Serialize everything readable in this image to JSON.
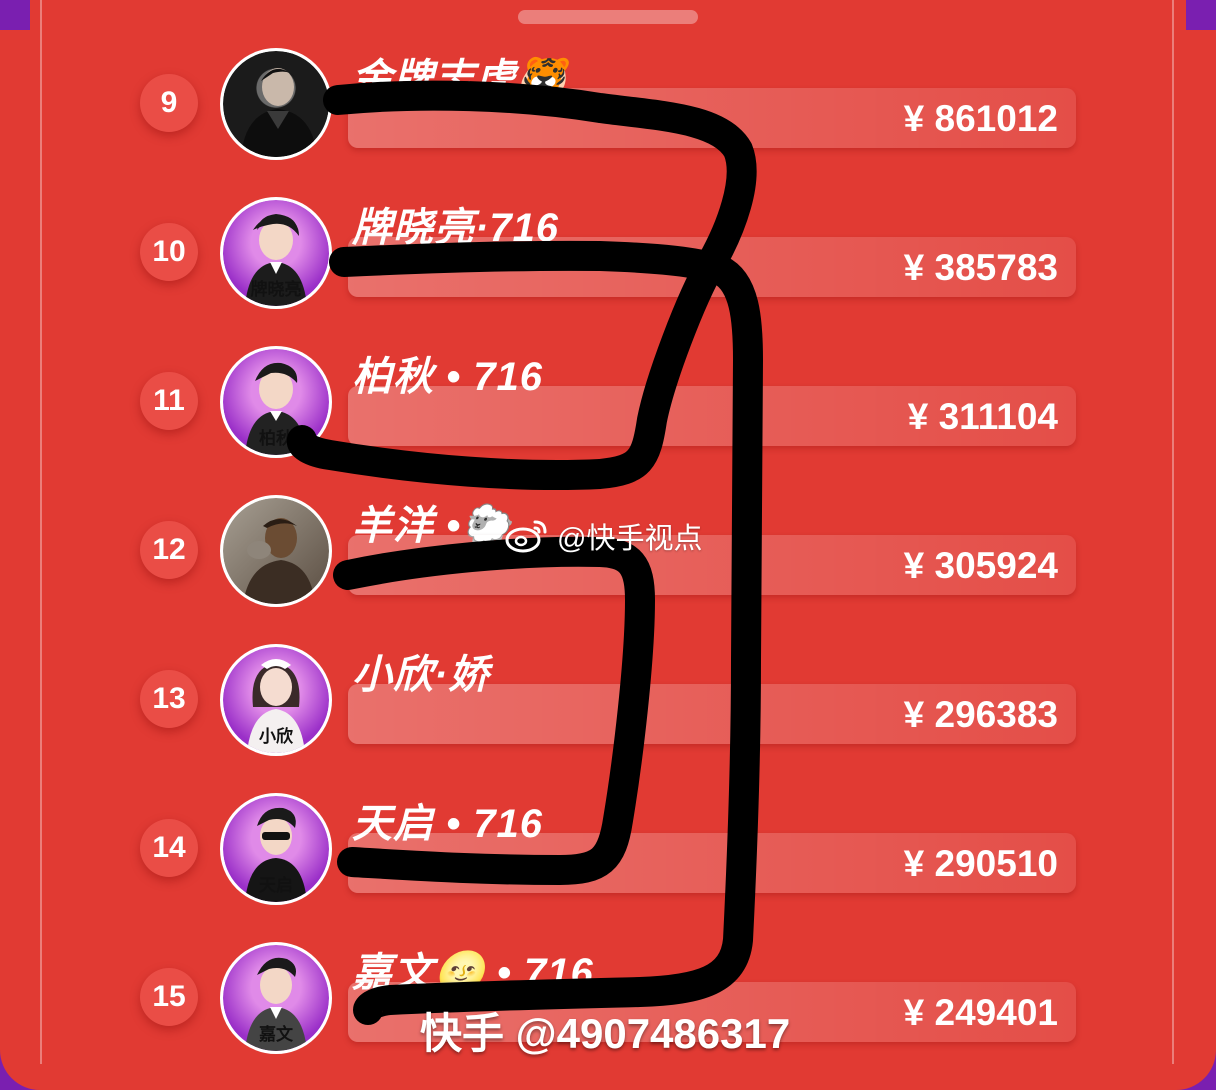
{
  "leaderboard": {
    "rows": [
      {
        "rank": "9",
        "name": "金牌志虎",
        "name_emoji": "🐯",
        "avatar_caption": "",
        "amount": "¥ 861012",
        "avatar_style": "photo-dark"
      },
      {
        "rank": "10",
        "name": "牌晓亮·716",
        "name_emoji": "",
        "avatar_caption": "牌晓亮",
        "amount": "¥ 385783",
        "avatar_style": "cartoon-purple"
      },
      {
        "rank": "11",
        "name": "柏秋 • 716",
        "name_emoji": "",
        "avatar_caption": "柏秋",
        "amount": "¥ 311104",
        "avatar_style": "cartoon-purple"
      },
      {
        "rank": "12",
        "name": "羊洋 •",
        "name_emoji": "🐑",
        "avatar_caption": "",
        "amount": "¥ 305924",
        "avatar_style": "photo-brown"
      },
      {
        "rank": "13",
        "name": "小欣·娇",
        "name_emoji": "",
        "avatar_caption": "小欣",
        "amount": "¥ 296383",
        "avatar_style": "cartoon-purple"
      },
      {
        "rank": "14",
        "name": "天启 • 716",
        "name_emoji": "",
        "avatar_caption": "天启",
        "amount": "¥ 290510",
        "avatar_style": "cartoon-purple"
      },
      {
        "rank": "15",
        "name": "嘉文",
        "name_emoji": "🌝",
        "name_suffix": " • 716",
        "avatar_caption": "嘉文",
        "amount": "¥ 249401",
        "avatar_style": "cartoon-purple"
      }
    ]
  },
  "watermark": {
    "text": "@快手视点",
    "icon": "weibo-icon"
  },
  "footer": {
    "text": "快手 @4907486317"
  },
  "colors": {
    "panel": "#e13a33",
    "background": "#7a1fb0",
    "scribble": "#000000"
  }
}
